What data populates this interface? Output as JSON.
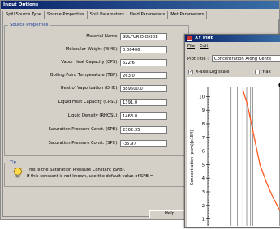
{
  "window": {
    "title": "Input Options"
  },
  "tabs": [
    {
      "label": "Spill Source Type",
      "active": false
    },
    {
      "label": "Source Properties",
      "active": true
    },
    {
      "label": "Spill Parameters",
      "active": false
    },
    {
      "label": "Field Parameters",
      "active": false
    },
    {
      "label": "Met Parameters",
      "active": false
    }
  ],
  "source_properties": {
    "group_title": "Source Properties",
    "fields": [
      {
        "label": "Material Name:",
        "value": "SULFUR DIOXIDE"
      },
      {
        "label": "Molecular Weight (WMS):",
        "value": "0.06406"
      },
      {
        "label": "Vapor Heat Capacity (CPS):",
        "value": "622.6"
      },
      {
        "label": "Boiling Point Temperature (TBP):",
        "value": "263.0"
      },
      {
        "label": "Heat of Vaporization (DHE):",
        "value": "389500.0"
      },
      {
        "label": "Liquid Heat Capacity (CPSL):",
        "value": "1391.0"
      },
      {
        "label": "Liquid Density (RHOSL):",
        "value": "1463.0"
      },
      {
        "label": "Saturation Pressure Const. (SPB):",
        "value": "2302.35"
      },
      {
        "label": "Saturation Pressure Const. (SPC):",
        "value": "-35.97"
      }
    ]
  },
  "tip": {
    "title": "Tip",
    "line1": "This is the Saturation Pressure Constant (SPB).",
    "line2": "If this constant is not known, use the default value of SPB ="
  },
  "buttons": {
    "help": "Help"
  },
  "xy_plot": {
    "title": "XY Plot",
    "menu": [
      "File",
      "Edit"
    ],
    "plot_title_label": "Plot Title :",
    "plot_title_value": "Concentration Along Cente",
    "xaxis_log_label": "X-axis Log scale",
    "xaxis_log_checked": true,
    "yaxis_label_partial": "Y-ax",
    "chart_heading": "C"
  },
  "chart_data": {
    "type": "line",
    "ylabel": "Concentration (ppm)[x1E4]",
    "y_ticks": [
      "10",
      "9",
      "8",
      "7",
      "6",
      "5",
      "4",
      "3",
      "2",
      "1"
    ],
    "ylim": [
      0.5,
      10.5
    ],
    "series": [
      {
        "color": "#ff5a1e",
        "x": [
          0.0,
          0.1,
          0.2,
          0.3,
          0.4,
          0.55,
          0.7,
          0.85,
          1.0
        ],
        "y": [
          10.5,
          9.5,
          8.0,
          6.5,
          5.0,
          3.7,
          2.6,
          1.7,
          1.0
        ]
      }
    ]
  },
  "colors": {
    "titlebar_start": "#0a246a",
    "titlebar_end": "#3a6ea5",
    "group_label": "#1b3f9a",
    "series": "#ff5a1e"
  }
}
